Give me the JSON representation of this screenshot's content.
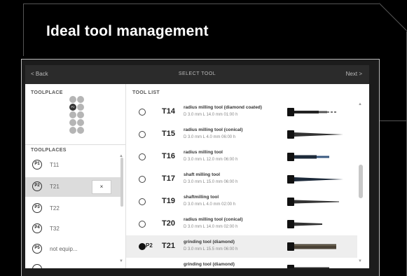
{
  "header": {
    "title": "Ideal tool management"
  },
  "topbar": {
    "back_label": "< Back",
    "title": "SELECT TOOL",
    "next_label": "Next >"
  },
  "toolplace": {
    "label": "TOOLPLACE",
    "active_marker": "P2"
  },
  "toolplaces": {
    "label": "TOOLPLACES",
    "remove_label": "×",
    "items": [
      {
        "badge": "P1",
        "value": "T11"
      },
      {
        "badge": "P2",
        "value": "T21"
      },
      {
        "badge": "P3",
        "value": "T22"
      },
      {
        "badge": "P4",
        "value": "T32"
      },
      {
        "badge": "P5",
        "value": "not equip..."
      }
    ]
  },
  "tool_list": {
    "label": "TOOL LIST",
    "items": [
      {
        "id": "T14",
        "name": "radius milling tool (diamond coated)",
        "dims": "D 3.0 mm L 14.0 mm 01:00 h"
      },
      {
        "id": "T15",
        "name": "radius milling tool (conical)",
        "dims": "D 3.0 mm L 4.0 mm 06:00 h"
      },
      {
        "id": "T16",
        "name": "radius milling tool",
        "dims": "D 3.0 mm L 12.0 mm 06:00 h"
      },
      {
        "id": "T17",
        "name": "shaft milling tool",
        "dims": "D 3.0 mm L 15.0 mm 06:00 h"
      },
      {
        "id": "T19",
        "name": "shaftmilling tool",
        "dims": "D 3.0 mm L 4.0 mm 02:00 h"
      },
      {
        "id": "T20",
        "name": "radius milling tool (conical)",
        "dims": "D 3.0 mm L 14.0 mm 02:00 h"
      },
      {
        "id": "T21",
        "pos": "P2",
        "name": "grinding tool (diamond)",
        "dims": "D 3.0 mm L 15.5 mm 06:00 h"
      },
      {
        "id": "",
        "name": "grinding tool (diamond)",
        "dims": ""
      }
    ]
  }
}
